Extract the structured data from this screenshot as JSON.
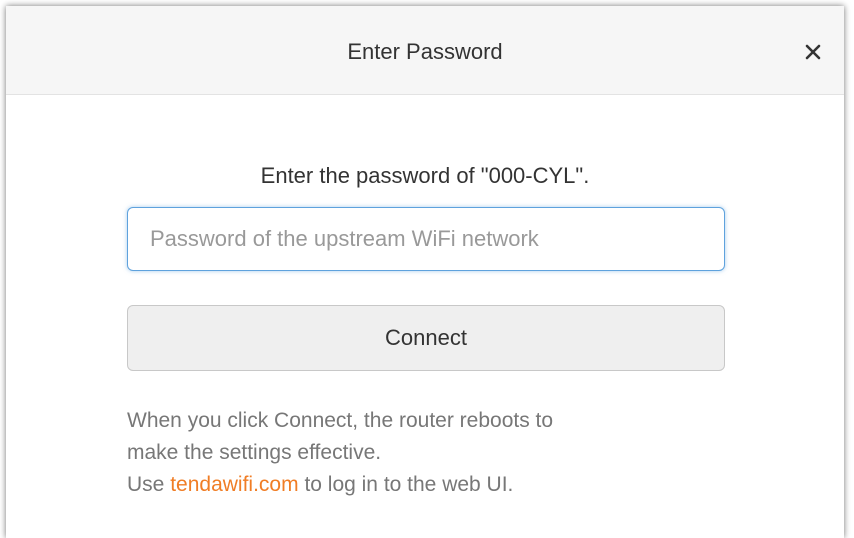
{
  "dialog": {
    "title": "Enter Password",
    "close_label": "×"
  },
  "prompt": "Enter the password of \"000-CYL\".",
  "password": {
    "value": "",
    "placeholder": "Password of the upstream WiFi network"
  },
  "connect_label": "Connect",
  "note": {
    "line1": "When you click Connect, the router reboots to",
    "line2": "make the settings effective.",
    "line3_prefix": "Use",
    "link_text": "tendawifi.com",
    "line3_suffix": "to log in to the web UI."
  },
  "colors": {
    "link": "#f07d25",
    "input_focus_border": "#5fa2dd",
    "header_bg": "#f6f6f6",
    "button_bg": "#efefef"
  },
  "icons": {
    "close": "close-icon"
  }
}
